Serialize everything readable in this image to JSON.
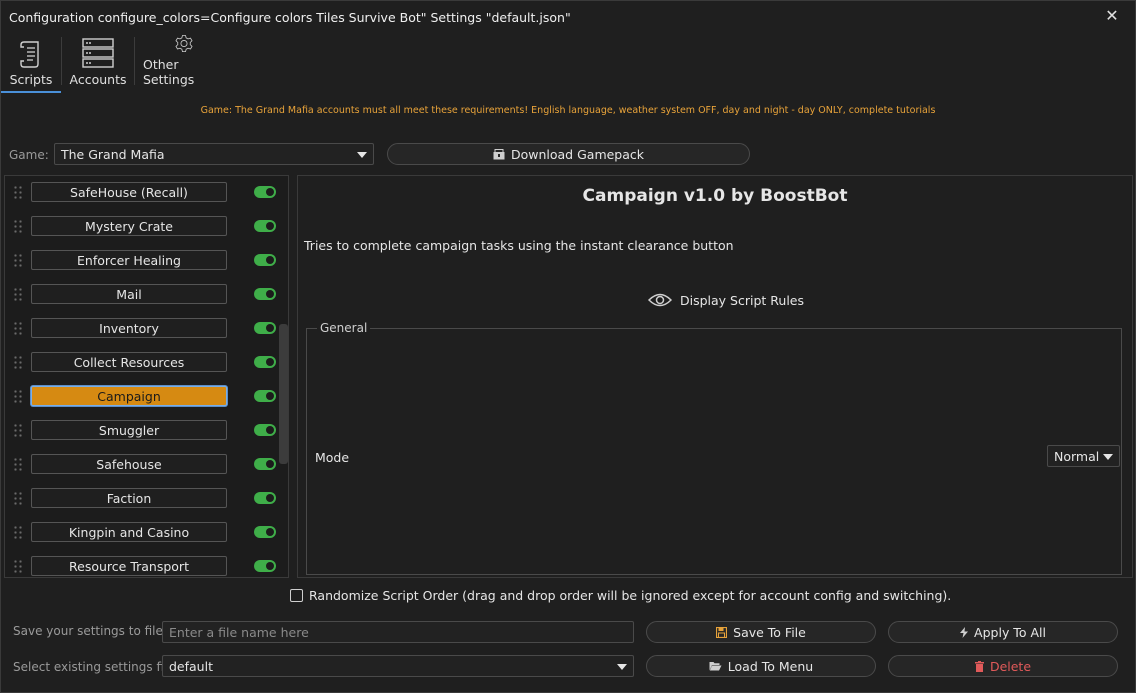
{
  "window": {
    "title": "Configuration configure_colors=Configure colors Tiles Survive Bot\" Settings \"default.json\"",
    "close_symbol": "✕"
  },
  "toolbar": {
    "items": [
      {
        "label": "Scripts",
        "icon": "scroll-icon",
        "active": true
      },
      {
        "label": "Accounts",
        "icon": "server-rack-icon",
        "active": false
      },
      {
        "label": "Other Settings",
        "icon": "gear-icon",
        "active": false
      }
    ]
  },
  "notice": "Game: The Grand Mafia accounts must all meet these requirements! English language, weather system OFF, day and night - day ONLY, complete tutorials",
  "game": {
    "label": "Game:",
    "selected": "The Grand Mafia",
    "download_label": "Download Gamepack"
  },
  "scripts": [
    {
      "name": "SafeHouse (Recall)",
      "enabled": true
    },
    {
      "name": "Mystery Crate",
      "enabled": true
    },
    {
      "name": "Enforcer Healing",
      "enabled": true
    },
    {
      "name": "Mail",
      "enabled": true
    },
    {
      "name": "Inventory",
      "enabled": true
    },
    {
      "name": "Collect Resources",
      "enabled": true
    },
    {
      "name": "Campaign",
      "enabled": true,
      "selected": true
    },
    {
      "name": "Smuggler",
      "enabled": true
    },
    {
      "name": "Safehouse",
      "enabled": true
    },
    {
      "name": "Faction",
      "enabled": true
    },
    {
      "name": "Kingpin and Casino",
      "enabled": true
    },
    {
      "name": "Resource Transport",
      "enabled": true
    }
  ],
  "detail": {
    "title": "Campaign v1.0 by BoostBot",
    "description": "Tries to complete campaign tasks using the instant clearance button",
    "rules_label": "Display Script Rules",
    "group_title": "General",
    "mode_label": "Mode",
    "mode_value": "Normal"
  },
  "randomize": {
    "label": "Randomize Script Order (drag and drop order will be ignored except for account config and switching).",
    "checked": false
  },
  "bottom": {
    "save_label": "Save your settings to file",
    "save_placeholder": "Enter a file name here",
    "save_to_file": "Save To File",
    "apply_to_all": "Apply To All",
    "select_label": "Select existing settings file",
    "select_value": "default",
    "load_to_menu": "Load To Menu",
    "delete": "Delete"
  },
  "colors": {
    "accent": "#4a90d9",
    "selected_script": "#d68a12",
    "toggle_on": "#3fae49",
    "notice": "#e8a33a",
    "delete": "#e05a5a"
  }
}
